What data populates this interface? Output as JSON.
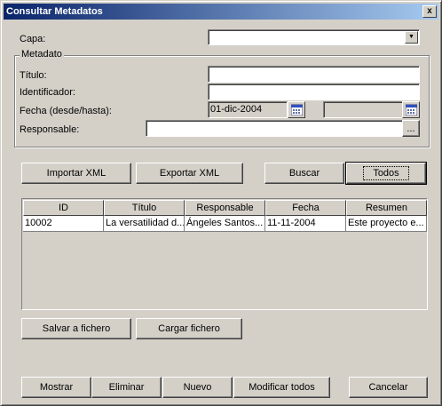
{
  "window": {
    "title": "Consultar Metadatos",
    "close_glyph": "x"
  },
  "capa": {
    "label": "Capa:",
    "value": ""
  },
  "metadato": {
    "group_title": "Metadato",
    "titulo_label": "Título:",
    "titulo_value": "",
    "identificador_label": "Identificador:",
    "identificador_value": "",
    "fecha_label": "Fecha (desde/hasta):",
    "fecha_desde": "01-dic-2004",
    "fecha_hasta": "",
    "responsable_label": "Responsable:",
    "responsable_value": "",
    "browse_label": "..."
  },
  "actions": {
    "importar": "Importar XML",
    "exportar": "Exportar XML",
    "buscar": "Buscar",
    "todos": "Todos"
  },
  "table": {
    "columns": [
      "ID",
      "Título",
      "Responsable",
      "Fecha",
      "Resumen"
    ],
    "rows": [
      [
        "10002",
        "La versatilidad d...",
        "Ángeles Santos...",
        "11-11-2004",
        "Este proyecto e..."
      ]
    ]
  },
  "file_actions": {
    "salvar": "Salvar a fichero",
    "cargar": "Cargar fichero"
  },
  "bottom": {
    "mostrar": "Mostrar",
    "eliminar": "Eliminar",
    "nuevo": "Nuevo",
    "modificar": "Modificar todos",
    "cancelar": "Cancelar"
  },
  "icons": {
    "dropdown": "chevron-down-icon",
    "calendar": "calendar-icon",
    "close": "close-icon"
  }
}
